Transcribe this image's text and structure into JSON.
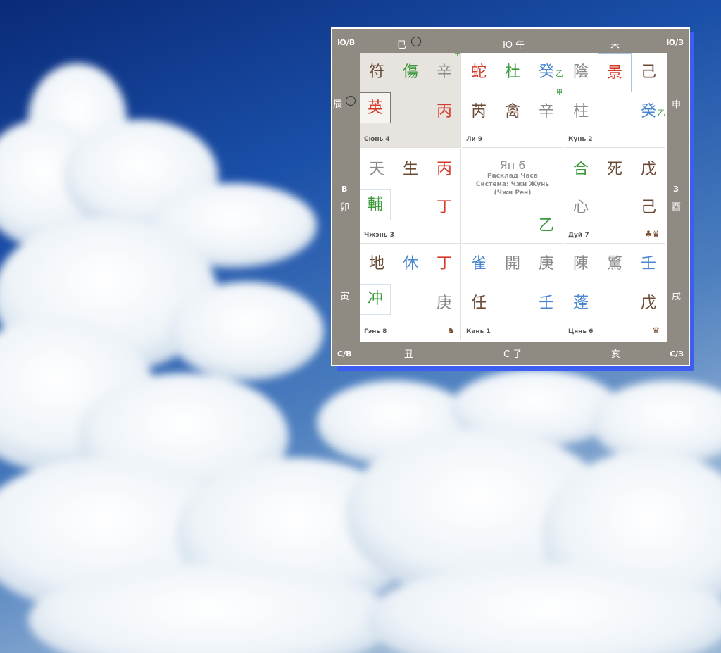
{
  "colors": {
    "accent_blue": "#3d5ef0",
    "frame": "#8f8a82",
    "green": "#3c9a3c",
    "red": "#d63a2a",
    "blue": "#4a86d0",
    "brown": "#6b4a35"
  },
  "frame": {
    "nw": "Ю/В",
    "ne": "Ю/З",
    "sw": "С/В",
    "se": "С/З",
    "top": [
      "巳",
      "Ю 午",
      "未"
    ],
    "bottom": [
      "丑",
      "С 子",
      "亥"
    ],
    "left_top": "辰",
    "left_mid_dir": "В",
    "left_mid": "卯",
    "left_bottom": "寅",
    "right_top": "申",
    "right_mid_dir": "З",
    "right_mid": "酉",
    "right_bottom": "戌"
  },
  "palaces": [
    {
      "name": "Сюнь 4",
      "r1": [
        "符",
        "傷",
        "辛"
      ],
      "r1_sup": "甲",
      "r2": [
        "英",
        "",
        "丙"
      ]
    },
    {
      "name": "Ли 9",
      "r1": [
        "蛇",
        "杜",
        "癸"
      ],
      "r1_sub": "乙",
      "r2": [
        "芮",
        "禽",
        "辛"
      ],
      "r2_sup": "甲"
    },
    {
      "name": "Кунь 2",
      "r1": [
        "陰",
        "景",
        "己"
      ],
      "r2": [
        "柱",
        "",
        "癸"
      ],
      "r2_sub": "乙"
    },
    {
      "name": "Чжэнь 3",
      "r1": [
        "天",
        "生",
        "丙"
      ],
      "r2": [
        "輔",
        "",
        "丁"
      ]
    },
    {
      "title": "Ян 6",
      "line1": "Расклад Часа",
      "line2": "Система: Чжи Жунь",
      "line3": "(Чжи Рен)",
      "bottom": "乙"
    },
    {
      "name": "Дуй 7",
      "r1": [
        "合",
        "死",
        "戊"
      ],
      "r2": [
        "心",
        "",
        "己"
      ],
      "piece": "♣♛"
    },
    {
      "name": "Гэнь 8",
      "r1": [
        "地",
        "休",
        "丁"
      ],
      "r2": [
        "冲",
        "",
        "庚"
      ],
      "piece": "♞"
    },
    {
      "name": "Кань 1",
      "r1": [
        "雀",
        "開",
        "庚"
      ],
      "r2": [
        "任",
        "",
        "壬"
      ]
    },
    {
      "name": "Цянь 6",
      "r1": [
        "陳",
        "驚",
        "壬"
      ],
      "r2": [
        "蓬",
        "",
        "戊"
      ],
      "piece": "♛"
    }
  ]
}
